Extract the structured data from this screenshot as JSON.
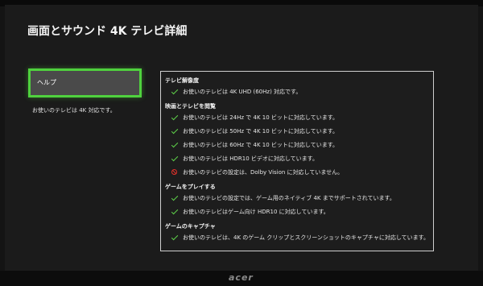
{
  "title": "画面とサウンド 4K テレビ詳細",
  "help": {
    "button_label": "ヘルプ",
    "description": "お使いのテレビは 4K 対応です。"
  },
  "sections": [
    {
      "title": "テレビ解像度",
      "items": [
        {
          "icon": "check-icon",
          "text": "お使いのテレビは 4K UHD (60Hz) 対応です。"
        }
      ]
    },
    {
      "title": "映画とテレビを閲覧",
      "items": [
        {
          "icon": "check-icon",
          "text": "お使いのテレビは 24Hz で 4K 10 ビットに対応しています。"
        },
        {
          "icon": "check-icon",
          "text": "お使いのテレビは 50Hz で 4K 10 ビットに対応しています。"
        },
        {
          "icon": "check-icon",
          "text": "お使いのテレビは 60Hz で 4K 10 ビットに対応しています。"
        },
        {
          "icon": "check-icon",
          "text": "お使いのテレビは HDR10 ビデオに対応しています。"
        },
        {
          "icon": "no-entry-icon",
          "text": "お使いのテレビの設定は、Dolby Vision に対応していません。"
        }
      ]
    },
    {
      "title": "ゲームをプレイする",
      "items": [
        {
          "icon": "check-icon",
          "text": "お使いのテレビの設定では、ゲーム用のネイティブ 4K までサポートされています。"
        },
        {
          "icon": "check-icon",
          "text": "お使いのテレビはゲーム向け HDR10 に対応しています。"
        }
      ]
    },
    {
      "title": "ゲームのキャプチャ",
      "items": [
        {
          "icon": "check-icon",
          "text": "お使いのテレビは、4K のゲーム クリップとスクリーンショットのキャプチャに対応しています。"
        }
      ]
    }
  ],
  "monitor_brand": "acer",
  "colors": {
    "accent": "#4fd13e",
    "check": "#5fd24a",
    "error": "#e0312b",
    "background": "#1b1b1b"
  }
}
